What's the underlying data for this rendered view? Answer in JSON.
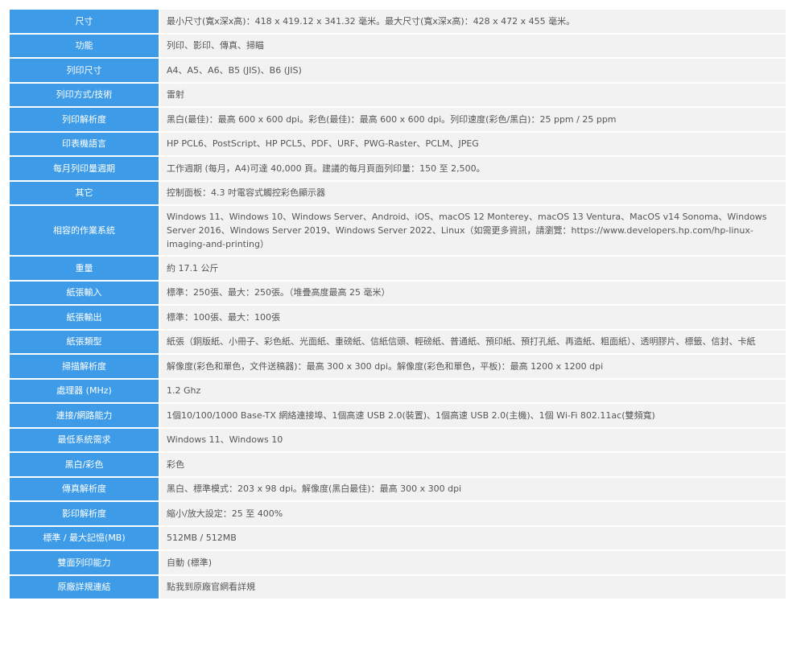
{
  "specs": [
    {
      "label": "尺寸",
      "value": "最小尺寸(寬x深x高)：418 x 419.12 x 341.32 毫米。最大尺寸(寬x深x高)：428 x 472 x 455 毫米。"
    },
    {
      "label": "功能",
      "value": "列印、影印、傳真、掃瞄"
    },
    {
      "label": "列印尺寸",
      "value": "A4、A5、A6、B5 (JIS)、B6 (JIS)"
    },
    {
      "label": "列印方式/技術",
      "value": "雷射"
    },
    {
      "label": "列印解析度",
      "value": "黑白(最佳)：最高 600 x 600 dpi。彩色(最佳)：最高 600 x 600 dpi。列印速度(彩色/黑白)：25 ppm / 25 ppm"
    },
    {
      "label": "印表機語言",
      "value": "HP PCL6、PostScript、HP PCL5、PDF、URF、PWG-Raster、PCLM、JPEG"
    },
    {
      "label": "每月列印量週期",
      "value": "工作週期 (每月，A4)可達 40,000 頁。建議的每月頁面列印量：150 至 2,500。"
    },
    {
      "label": "其它",
      "value": "控制面板：4.3 吋電容式觸控彩色顯示器"
    },
    {
      "label": "相容的作業系統",
      "value": "Windows 11、Windows 10、Windows Server、Android、iOS、macOS 12 Monterey、macOS 13 Ventura、MacOS v14 Sonoma、Windows Server 2016、Windows Server 2019、Windows Server 2022、Linux（如需更多資訊，請瀏覽：https://www.developers.hp.com/hp-linux-imaging-and-printing）"
    },
    {
      "label": "重量",
      "value": "約 17.1 公斤"
    },
    {
      "label": "紙張輸入",
      "value": "標準：250張、最大：250張。（堆疊高度最高 25 毫米）"
    },
    {
      "label": "紙張輸出",
      "value": "標準：100張、最大：100張"
    },
    {
      "label": "紙張類型",
      "value": "紙張（銅版紙、小冊子、彩色紙、光面紙、重磅紙、信紙信頭、輕磅紙、普通紙、預印紙、預打孔紙、再造紙、粗面紙）、透明膠片、標籤、信封、卡紙"
    },
    {
      "label": "掃描解析度",
      "value": "解像度(彩色和單色，文件送稿器)：最高 300 x 300 dpi。解像度(彩色和單色，平板)：最高 1200 x 1200 dpi"
    },
    {
      "label": "處理器 (MHz)",
      "value": "1.2 Ghz"
    },
    {
      "label": "連接/網路能力",
      "value": "1個10/100/1000 Base-TX 網絡連接埠、1個高速 USB 2.0(裝置)、1個高速 USB 2.0(主機)、1個 Wi-Fi 802.11ac(雙頻寬)"
    },
    {
      "label": "最低系統需求",
      "value": "Windows 11、Windows 10"
    },
    {
      "label": "黑白/彩色",
      "value": "彩色"
    },
    {
      "label": "傳真解析度",
      "value": "黑白、標準模式：203 x 98 dpi。解像度(黑白最佳)：最高 300 x 300 dpi"
    },
    {
      "label": "影印解析度",
      "value": "縮小/放大設定：25 至 400%"
    },
    {
      "label": "標準 / 最大記憶(MB)",
      "value": "512MB / 512MB"
    },
    {
      "label": "雙面列印能力",
      "value": "自動 (標準)"
    },
    {
      "label": "原廠詳規連結",
      "value": "點我到原廠官網看詳規"
    }
  ],
  "colors": {
    "label_bg": "#3d9be8",
    "label_text": "#ffffff",
    "value_bg": "#f2f2f2",
    "value_text": "#555555"
  }
}
